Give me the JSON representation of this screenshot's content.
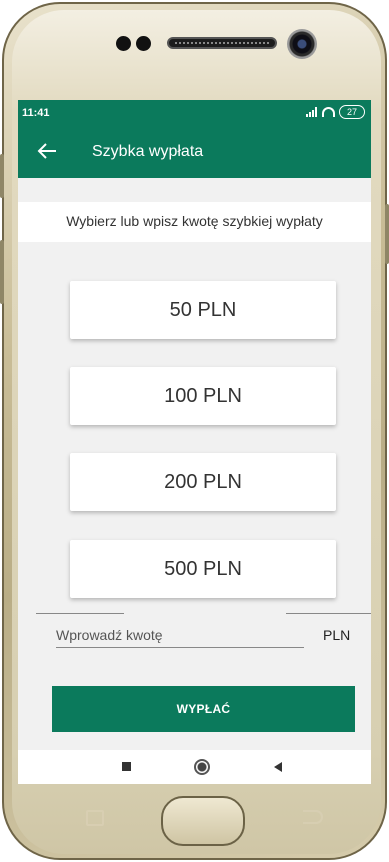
{
  "status_bar": {
    "time": "11:41",
    "battery": "27"
  },
  "header": {
    "title": "Szybka wypłata",
    "back_icon": "arrow-left-icon"
  },
  "prompt": "Wybierz lub wpisz kwotę szybkiej wypłaty",
  "amounts": [
    {
      "label": "50 PLN"
    },
    {
      "label": "100 PLN"
    },
    {
      "label": "200 PLN"
    },
    {
      "label": "500 PLN"
    }
  ],
  "custom_amount": {
    "placeholder": "Wprowadź kwotę",
    "value": "",
    "currency": "PLN"
  },
  "action": {
    "withdraw_label": "WYPŁAĆ"
  },
  "nav_bar": {
    "icons": [
      "recent-apps-icon",
      "home-icon",
      "back-icon"
    ]
  },
  "colors": {
    "brand": "#0b7a5c",
    "background": "#f1f1f1",
    "card": "#ffffff"
  }
}
